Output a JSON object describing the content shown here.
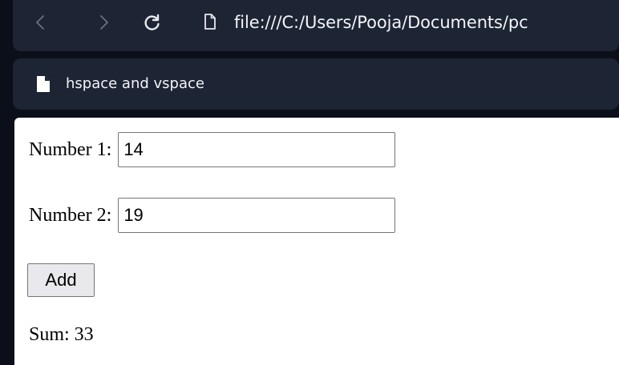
{
  "browser": {
    "url": "file:///C:/Users/Pooja/Documents/pc",
    "icons": {
      "back": "chevron-left-icon",
      "forward": "chevron-right-icon",
      "reload": "reload-icon",
      "page": "file-icon"
    }
  },
  "tab": {
    "title": "hspace and vspace",
    "icon": "document-icon"
  },
  "form": {
    "number1": {
      "label": "Number 1:",
      "value": "14"
    },
    "number2": {
      "label": "Number 2:",
      "value": "19"
    },
    "add_button": "Add",
    "sum": "Sum: 33"
  },
  "colors": {
    "chrome_background": "#0b0f1a",
    "bar_background": "#1d2433",
    "text_light": "#f2f4f8",
    "icon_dim": "#6a7284",
    "page_background": "#ffffff",
    "button_background": "#e9e9ed"
  }
}
